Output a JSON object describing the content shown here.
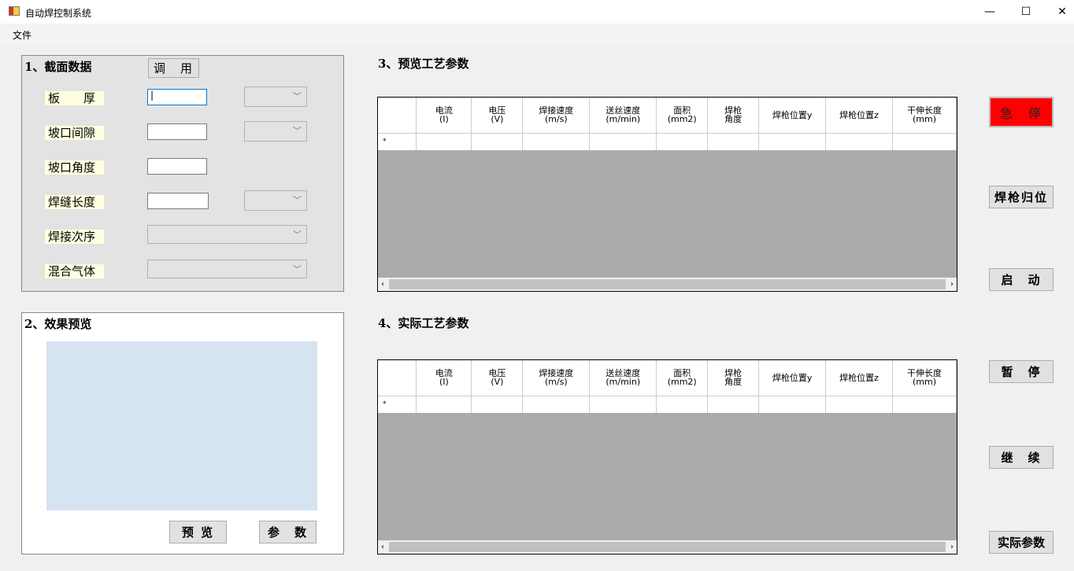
{
  "window": {
    "title": "自动焊控制系统",
    "minimize": "—",
    "maximize": "☐",
    "close": "✕"
  },
  "menu": {
    "file": "文件"
  },
  "section1": {
    "title": "1、截面数据",
    "call_button": "调　用",
    "fields": [
      {
        "label": "板　　厚",
        "value": "|"
      },
      {
        "label": "坡口间隙",
        "value": ""
      },
      {
        "label": "坡口角度",
        "value": ""
      },
      {
        "label": "焊缝长度",
        "value": ""
      },
      {
        "label": "焊接次序",
        "value": ""
      },
      {
        "label": "混合气体",
        "value": ""
      }
    ]
  },
  "section2": {
    "title": "2、效果预览",
    "preview_button": "预 览",
    "params_button": "参　数"
  },
  "section3": {
    "title": "3、预览工艺参数"
  },
  "section4": {
    "title": "4、实际工艺参数"
  },
  "columns": [
    "电流\n(I)",
    "电压\n(V)",
    "焊接速度\n(m/s)",
    "送丝速度\n(m/min)",
    "面积\n(mm2)",
    "焊枪\n角度",
    "焊枪位置y",
    "焊枪位置z",
    "干伸长度\n(mm)"
  ],
  "new_row_marker": "*",
  "scroll": {
    "left": "‹",
    "right": "›"
  },
  "buttons": {
    "estop": "急　停",
    "home": "焊枪归位",
    "start": "启　动",
    "pause": "暂　停",
    "resume": "继　续",
    "actual": "实际参数"
  },
  "colors": {
    "estop": "#ff0000",
    "preview_bg": "#d6e3f0",
    "grid_bg": "#ababab"
  }
}
